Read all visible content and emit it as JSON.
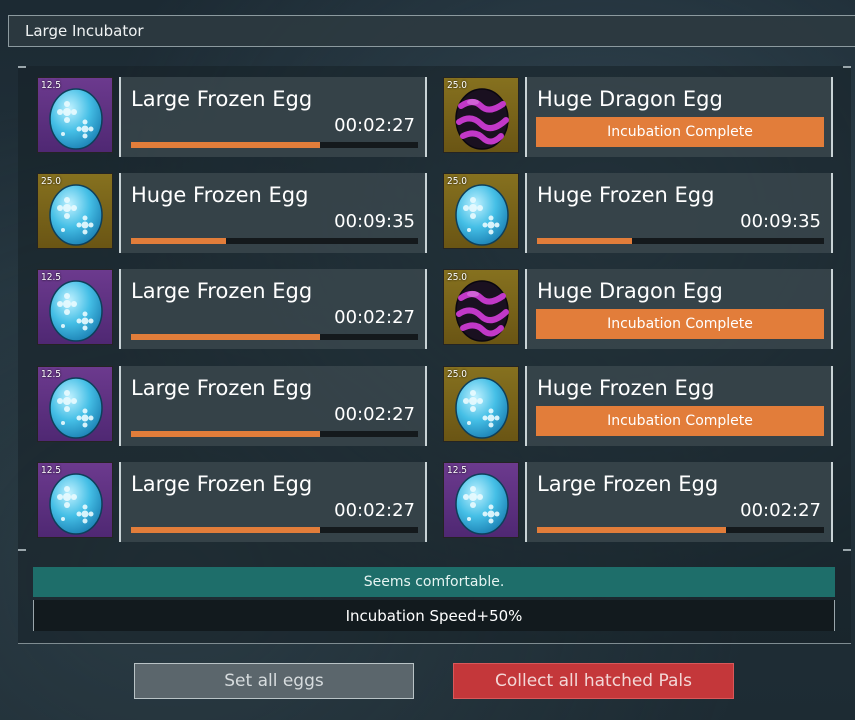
{
  "window": {
    "title": "Large Incubator"
  },
  "slots": [
    {
      "size_value": "12.5",
      "tier": "purple",
      "egg_icon": "frozen-egg-icon",
      "name": "Large Frozen Egg",
      "timer": "00:02:27",
      "progress": 0.66,
      "complete": false
    },
    {
      "size_value": "25.0",
      "tier": "gold",
      "egg_icon": "dragon-egg-icon",
      "name": "Huge Dragon Egg",
      "status": "Incubation Complete",
      "complete": true
    },
    {
      "size_value": "25.0",
      "tier": "gold",
      "egg_icon": "frozen-egg-icon",
      "name": "Huge Frozen Egg",
      "timer": "00:09:35",
      "progress": 0.33,
      "complete": false
    },
    {
      "size_value": "25.0",
      "tier": "gold",
      "egg_icon": "frozen-egg-icon",
      "name": "Huge Frozen Egg",
      "timer": "00:09:35",
      "progress": 0.33,
      "complete": false
    },
    {
      "size_value": "12.5",
      "tier": "purple",
      "egg_icon": "frozen-egg-icon",
      "name": "Large Frozen Egg",
      "timer": "00:02:27",
      "progress": 0.66,
      "complete": false
    },
    {
      "size_value": "25.0",
      "tier": "gold",
      "egg_icon": "dragon-egg-icon",
      "name": "Huge Dragon Egg",
      "status": "Incubation Complete",
      "complete": true
    },
    {
      "size_value": "12.5",
      "tier": "purple",
      "egg_icon": "frozen-egg-icon",
      "name": "Large Frozen Egg",
      "timer": "00:02:27",
      "progress": 0.66,
      "complete": false
    },
    {
      "size_value": "25.0",
      "tier": "gold",
      "egg_icon": "frozen-egg-icon",
      "name": "Huge Frozen Egg",
      "status": "Incubation Complete",
      "complete": true
    },
    {
      "size_value": "12.5",
      "tier": "purple",
      "egg_icon": "frozen-egg-icon",
      "name": "Large Frozen Egg",
      "timer": "00:02:27",
      "progress": 0.66,
      "complete": false
    },
    {
      "size_value": "12.5",
      "tier": "purple",
      "egg_icon": "frozen-egg-icon",
      "name": "Large Frozen Egg",
      "timer": "00:02:27",
      "progress": 0.66,
      "complete": false
    }
  ],
  "status": {
    "comfort": "Seems comfortable.",
    "speed": "Incubation Speed+50%"
  },
  "buttons": {
    "set_all": "Set all eggs",
    "collect_all": "Collect all hatched Pals"
  },
  "colors": {
    "accent": "#e27d3a",
    "comfort_bar": "#1e6e6a",
    "collect_button": "#c4373a",
    "set_button": "#5b666c",
    "purple_tier": "#5e3281",
    "gold_tier": "#7a6419"
  }
}
